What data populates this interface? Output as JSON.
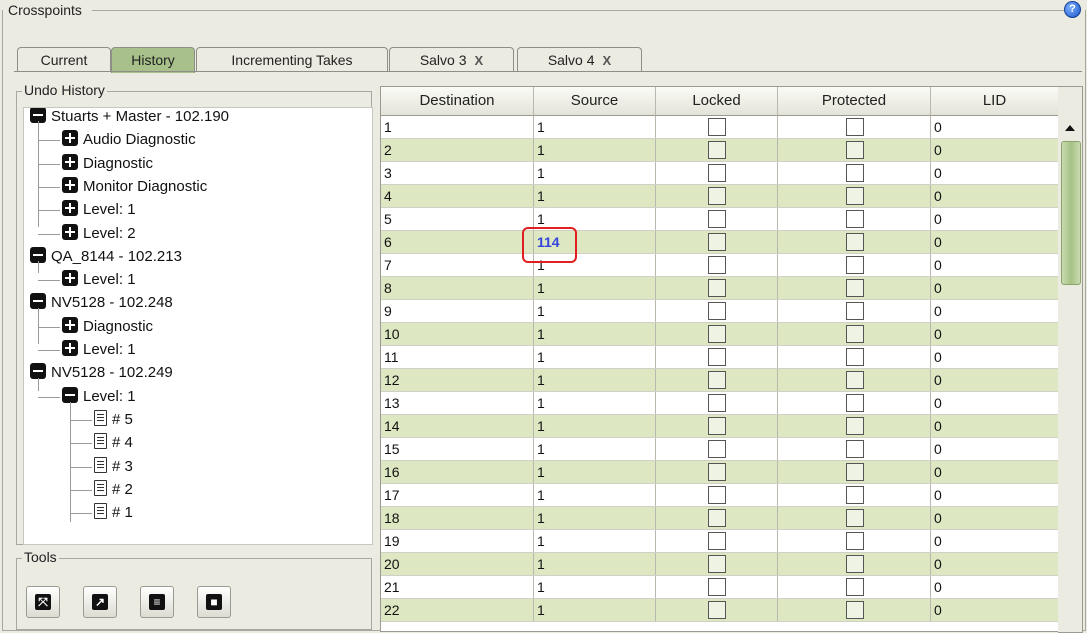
{
  "frame_title": "Crosspoints",
  "tabs": [
    {
      "label": "Current",
      "closable": false,
      "active": false
    },
    {
      "label": "History",
      "closable": false,
      "active": true
    },
    {
      "label": "Incrementing Takes",
      "closable": false,
      "active": false
    },
    {
      "label": "Salvo 3",
      "closable": true,
      "active": false
    },
    {
      "label": "Salvo 4",
      "closable": true,
      "active": false
    }
  ],
  "tab_close_glyph": "X",
  "undo_history": {
    "title": "Undo History",
    "items": [
      {
        "label": "Stuarts + Master - 102.190",
        "icon": "minus-icon"
      },
      {
        "label": "Audio Diagnostic",
        "icon": "plus-icon"
      },
      {
        "label": "Diagnostic",
        "icon": "plus-icon"
      },
      {
        "label": "Monitor Diagnostic",
        "icon": "plus-icon"
      },
      {
        "label": "Level: 1",
        "icon": "plus-icon"
      },
      {
        "label": "Level: 2",
        "icon": "plus-icon"
      },
      {
        "label": "QA_8144 - 102.213",
        "icon": "minus-icon"
      },
      {
        "label": "Level: 1",
        "icon": "plus-icon"
      },
      {
        "label": "NV5128 - 102.248",
        "icon": "minus-icon"
      },
      {
        "label": "Diagnostic",
        "icon": "plus-icon"
      },
      {
        "label": "Level: 1",
        "icon": "plus-icon"
      },
      {
        "label": "NV5128 - 102.249",
        "icon": "minus-icon"
      },
      {
        "label": "Level: 1",
        "icon": "minus-icon"
      },
      {
        "label": "# 5",
        "icon": "document-icon"
      },
      {
        "label": "# 4",
        "icon": "document-icon"
      },
      {
        "label": "# 3",
        "icon": "document-icon"
      },
      {
        "label": "# 2",
        "icon": "document-icon"
      },
      {
        "label": "# 1",
        "icon": "document-icon"
      }
    ]
  },
  "tools": {
    "title": "Tools",
    "buttons": [
      {
        "icon": "shuffle-icon"
      },
      {
        "icon": "arrow-out-icon"
      },
      {
        "icon": "document-icon"
      },
      {
        "icon": "save-icon"
      }
    ]
  },
  "grid": {
    "columns": [
      "Destination",
      "Source",
      "Locked",
      "Protected",
      "LID"
    ],
    "rows": [
      {
        "destination": "1",
        "source": "1",
        "lid": "0"
      },
      {
        "destination": "2",
        "source": "1",
        "lid": "0"
      },
      {
        "destination": "3",
        "source": "1",
        "lid": "0"
      },
      {
        "destination": "4",
        "source": "1",
        "lid": "0"
      },
      {
        "destination": "5",
        "source": "1",
        "lid": "0"
      },
      {
        "destination": "6",
        "source": "114",
        "lid": "0",
        "highlight": true
      },
      {
        "destination": "7",
        "source": "1",
        "lid": "0"
      },
      {
        "destination": "8",
        "source": "1",
        "lid": "0"
      },
      {
        "destination": "9",
        "source": "1",
        "lid": "0"
      },
      {
        "destination": "10",
        "source": "1",
        "lid": "0"
      },
      {
        "destination": "11",
        "source": "1",
        "lid": "0"
      },
      {
        "destination": "12",
        "source": "1",
        "lid": "0"
      },
      {
        "destination": "13",
        "source": "1",
        "lid": "0"
      },
      {
        "destination": "14",
        "source": "1",
        "lid": "0"
      },
      {
        "destination": "15",
        "source": "1",
        "lid": "0"
      },
      {
        "destination": "16",
        "source": "1",
        "lid": "0"
      },
      {
        "destination": "17",
        "source": "1",
        "lid": "0"
      },
      {
        "destination": "18",
        "source": "1",
        "lid": "0"
      },
      {
        "destination": "19",
        "source": "1",
        "lid": "0"
      },
      {
        "destination": "20",
        "source": "1",
        "lid": "0"
      },
      {
        "destination": "21",
        "source": "1",
        "lid": "0"
      },
      {
        "destination": "22",
        "source": "1",
        "lid": "0"
      }
    ]
  },
  "colors": {
    "accent": "#a8c18a",
    "row_alt": "#dde8c3",
    "highlight_text": "#3344dd",
    "highlight_box": "#e02020"
  }
}
